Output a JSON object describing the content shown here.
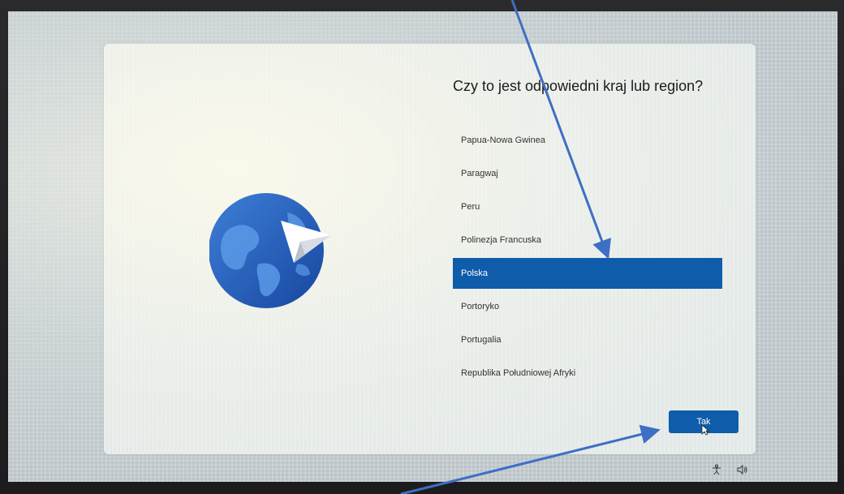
{
  "oobe": {
    "heading": "Czy to jest odpowiedni kraj lub region?",
    "countries": [
      {
        "label": "Papua-Nowa Gwinea",
        "selected": false
      },
      {
        "label": "Paragwaj",
        "selected": false
      },
      {
        "label": "Peru",
        "selected": false
      },
      {
        "label": "Polinezja Francuska",
        "selected": false
      },
      {
        "label": "Polska",
        "selected": true
      },
      {
        "label": "Portoryko",
        "selected": false
      },
      {
        "label": "Portugalia",
        "selected": false
      },
      {
        "label": "Republika Południowej Afryki",
        "selected": false
      }
    ],
    "next_button": "Tak"
  },
  "tray": {
    "icons": [
      "accessibility-icon",
      "volume-icon"
    ]
  },
  "colors": {
    "accent": "#0f5cab",
    "globe_dark": "#1a4fae",
    "globe_light": "#4e8ee0",
    "annotation_arrow": "#3d6fc4"
  }
}
